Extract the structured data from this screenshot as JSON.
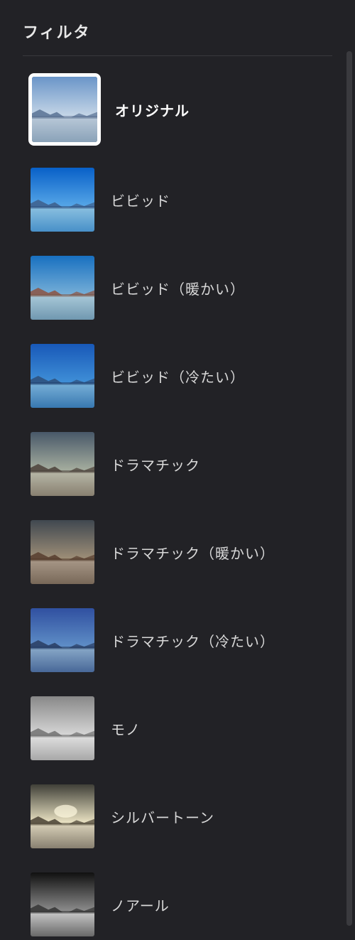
{
  "header": {
    "title": "フィルタ"
  },
  "filters": [
    {
      "id": "original",
      "label": "オリジナル",
      "selected": true,
      "thumb_style": "original"
    },
    {
      "id": "vivid",
      "label": "ビビッド",
      "selected": false,
      "thumb_style": "vivid"
    },
    {
      "id": "vivid-warm",
      "label": "ビビッド（暖かい）",
      "selected": false,
      "thumb_style": "vivid-warm"
    },
    {
      "id": "vivid-cool",
      "label": "ビビッド（冷たい）",
      "selected": false,
      "thumb_style": "vivid-cool"
    },
    {
      "id": "dramatic",
      "label": "ドラマチック",
      "selected": false,
      "thumb_style": "dramatic"
    },
    {
      "id": "dramatic-warm",
      "label": "ドラマチック（暖かい）",
      "selected": false,
      "thumb_style": "dramatic-warm"
    },
    {
      "id": "dramatic-cool",
      "label": "ドラマチック（冷たい）",
      "selected": false,
      "thumb_style": "dramatic-cool"
    },
    {
      "id": "mono",
      "label": "モノ",
      "selected": false,
      "thumb_style": "mono"
    },
    {
      "id": "silvertone",
      "label": "シルバートーン",
      "selected": false,
      "thumb_style": "silvertone"
    },
    {
      "id": "noir",
      "label": "ノアール",
      "selected": false,
      "thumb_style": "noir"
    }
  ]
}
